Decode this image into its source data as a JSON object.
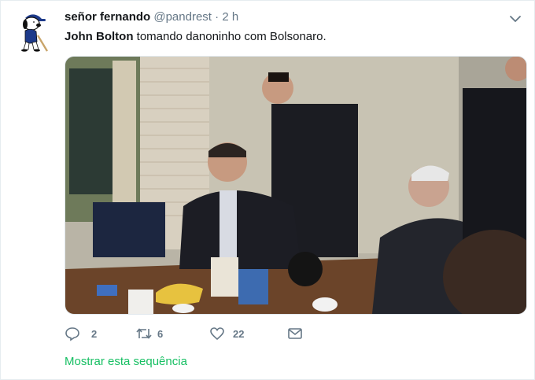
{
  "tweet": {
    "author": {
      "display_name": "señor fernando",
      "handle": "@pandrest",
      "separator": "·",
      "time": "2 h"
    },
    "text": {
      "bold": "John Bolton",
      "rest": " tomando danoninho com Bolsonaro."
    },
    "avatar_icon": "snoopy-avatar-icon",
    "menu_icon": "chevron-down-icon",
    "media": {
      "description_icon": "photo-image"
    },
    "actions": {
      "reply": {
        "icon": "reply-icon",
        "count": "2"
      },
      "retweet": {
        "icon": "retweet-icon",
        "count": "6"
      },
      "like": {
        "icon": "heart-icon",
        "count": "22"
      },
      "dm": {
        "icon": "envelope-icon"
      }
    },
    "show_thread": "Mostrar esta sequência"
  },
  "colors": {
    "text": "#14171a",
    "secondary": "#657786",
    "link_green": "#17bf63",
    "border": "#e6ecf0"
  }
}
